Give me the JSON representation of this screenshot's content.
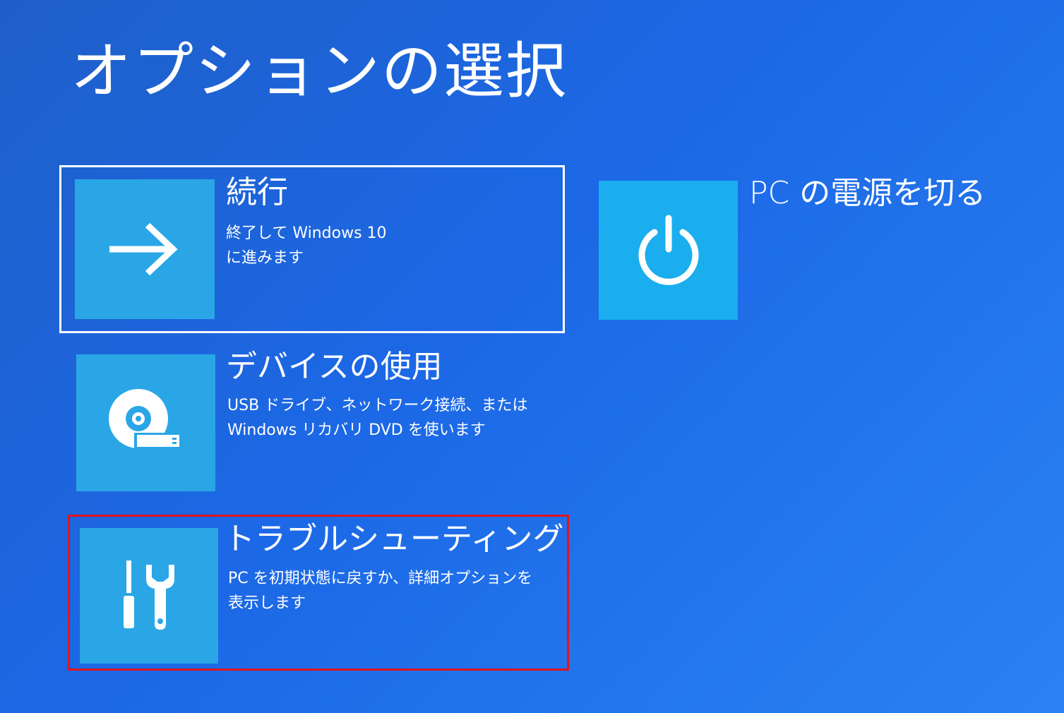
{
  "page": {
    "title": "オプションの選択"
  },
  "options": {
    "continue": {
      "title": "続行",
      "desc_line1": "終了して Windows 10",
      "desc_line2": "に進みます",
      "icon": "arrow-right-icon"
    },
    "use_device": {
      "title": "デバイスの使用",
      "desc_line1": "USB ドライブ、ネットワーク接続、または",
      "desc_line2": "Windows リカバリ DVD を使います",
      "icon": "disc-usb-icon"
    },
    "troubleshoot": {
      "title": "トラブルシューティング",
      "desc_line1": "PC を初期状態に戻すか、詳細オプションを",
      "desc_line2": "表示します",
      "icon": "screwdriver-wrench-icon"
    },
    "power_off": {
      "title": "PC の電源を切る",
      "icon": "power-icon"
    }
  },
  "colors": {
    "background": "#1c68e6",
    "tile_icon_bg": "#2aa6e6",
    "power_icon_bg": "#1aaeef",
    "focus_border": "#ffffff",
    "highlight_border": "#e0141e"
  }
}
